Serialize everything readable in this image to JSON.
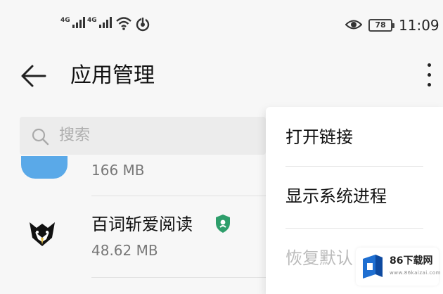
{
  "status_bar": {
    "signal1_label": "4G",
    "signal2_label": "4G",
    "battery_level": "78",
    "time": "11:09"
  },
  "header": {
    "title": "应用管理"
  },
  "search": {
    "placeholder": "搜索"
  },
  "apps": [
    {
      "name": "",
      "size": "166 MB",
      "icon": "blue-app-icon"
    },
    {
      "name": "百词斩爱阅读",
      "size": "48.62 MB",
      "icon": "book-fox-icon",
      "verified_badge": "shield-check-icon"
    }
  ],
  "menu": {
    "items": [
      "打开链接",
      "显示系统进程",
      "恢复默认"
    ]
  },
  "watermark": {
    "brand": "86下载网",
    "url": "www.86kaizai.com"
  },
  "colors": {
    "background": "#f7f7f7",
    "accent_blue": "#5aa9e8",
    "verify_green": "#2e9e6b"
  }
}
